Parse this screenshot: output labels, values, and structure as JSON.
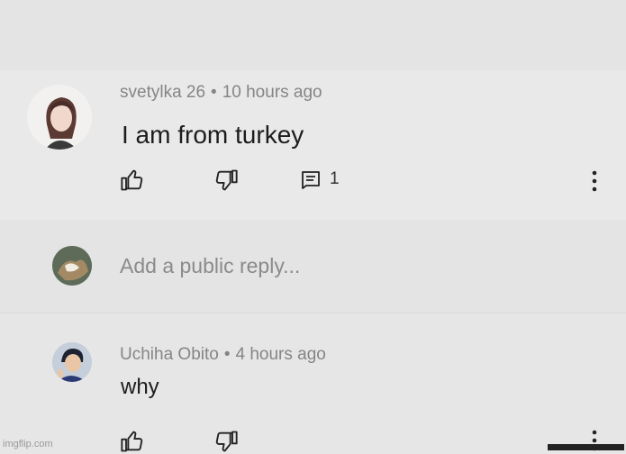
{
  "comment": {
    "author": "svetylka 26",
    "separator": "•",
    "time": "10 hours ago",
    "text": "I am from turkey",
    "reply_count": "1"
  },
  "reply_box": {
    "placeholder": "Add a public reply..."
  },
  "reply": {
    "author": "Uchiha Obito",
    "separator": "•",
    "time": "4 hours ago",
    "text": "why"
  },
  "watermark": "imgflip.com",
  "icons": {
    "like": "thumbs-up-icon",
    "dislike": "thumbs-down-icon",
    "replies": "comment-icon",
    "more": "more-vert-icon"
  }
}
